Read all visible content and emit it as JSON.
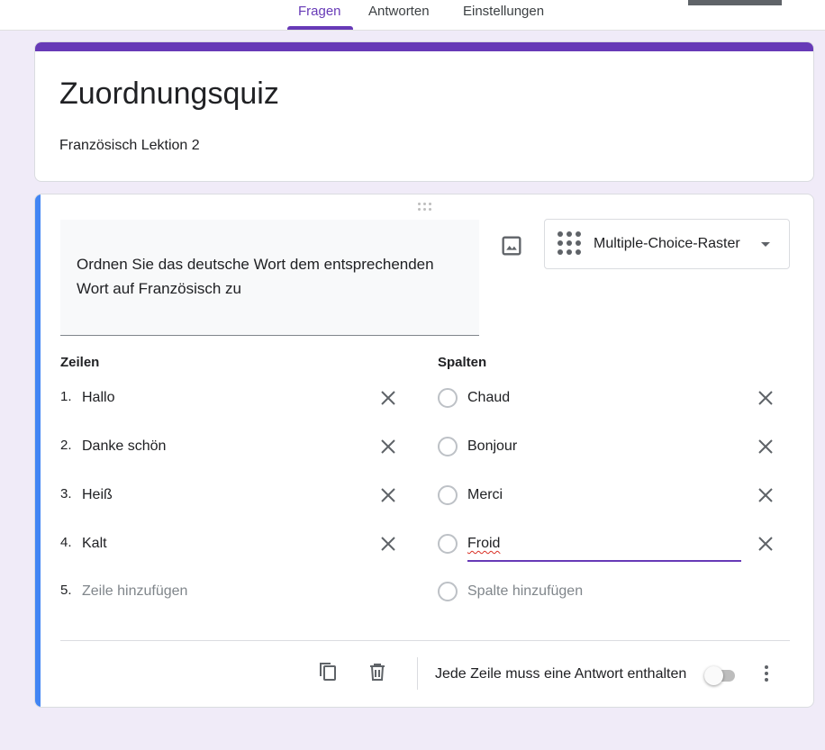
{
  "tabs": [
    {
      "label": "Fragen",
      "active": true
    },
    {
      "label": "Antworten",
      "active": false
    },
    {
      "label": "Einstellungen",
      "active": false
    }
  ],
  "form": {
    "title": "Zuordnungsquiz",
    "description": "Französisch Lektion 2"
  },
  "question": {
    "text": "Ordnen Sie das deutsche Wort dem entsprechenden Wort auf Französisch zu",
    "type_label": "Multiple-Choice-Raster",
    "type_icon": "grid-icon",
    "image_icon": "image-icon"
  },
  "rows": {
    "heading": "Zeilen",
    "items": [
      {
        "num": "1.",
        "label": "Hallo"
      },
      {
        "num": "2.",
        "label": "Danke schön"
      },
      {
        "num": "3.",
        "label": "Heiß"
      },
      {
        "num": "4.",
        "label": "Kalt"
      }
    ],
    "add": {
      "num": "5.",
      "label": "Zeile hinzufügen"
    }
  },
  "columns": {
    "heading": "Spalten",
    "items": [
      {
        "label": "Chaud"
      },
      {
        "label": "Bonjour"
      },
      {
        "label": "Merci"
      },
      {
        "label": "Froid"
      }
    ],
    "add": {
      "label": "Spalte hinzufügen"
    }
  },
  "footer": {
    "required_label": "Jede Zeile muss eine Antwort enthalten",
    "required_on": false
  },
  "colors": {
    "accent": "#673ab7",
    "active_card": "#4285f4",
    "background": "#f0ebf8"
  }
}
